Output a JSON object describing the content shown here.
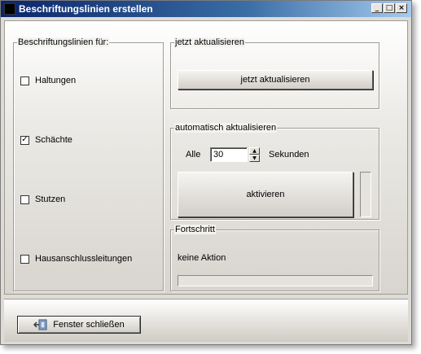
{
  "window": {
    "title": "Beschriftungslinien erstellen",
    "minimize_glyph": "_",
    "maximize_glyph": "□",
    "close_glyph": "×"
  },
  "labels_group": {
    "legend": "Beschriftungslinien für:",
    "items": [
      {
        "label": "Haltungen",
        "checked": false
      },
      {
        "label": "Schächte",
        "checked": true
      },
      {
        "label": "Stutzen",
        "checked": false
      },
      {
        "label": "Hausanschlussleitungen",
        "checked": false
      }
    ],
    "check_glyph": "✓"
  },
  "update_now": {
    "legend": "jetzt aktualisieren",
    "button_label": "jetzt aktualisieren"
  },
  "auto_update": {
    "legend": "automatisch aktualisieren",
    "prefix": "Alle",
    "interval_value": "30",
    "suffix": "Sekunden",
    "button_label": "aktivieren",
    "up_glyph": "▲",
    "down_glyph": "▼"
  },
  "progress": {
    "legend": "Fortschritt",
    "status": "keine Aktion",
    "fraction": 0
  },
  "footer": {
    "close_button_label": "Fenster schließen"
  },
  "colors": {
    "titlebar_start": "#0a246a",
    "titlebar_end": "#a6caf0",
    "window_bg": "#dedbd6"
  }
}
